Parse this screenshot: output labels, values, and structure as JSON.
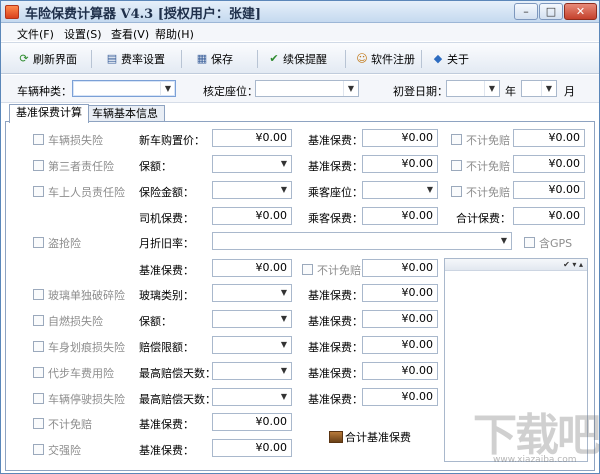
{
  "window": {
    "title": "车险保费计算器 V4.3 [授权用户：张建]",
    "min_glyph": "–",
    "max_glyph": "□",
    "close_glyph": "✕"
  },
  "menu": [
    "文件(F)",
    "设置(S)",
    "查看(V)",
    "帮助(H)"
  ],
  "toolbar": [
    {
      "label": "刷新界面",
      "icon": "refresh-icon",
      "glyph": "⟳"
    },
    {
      "label": "费率设置",
      "icon": "rate-settings-icon",
      "glyph": "▤"
    },
    {
      "label": "保存",
      "icon": "save-icon",
      "glyph": "▦"
    },
    {
      "label": "续保提醒",
      "icon": "checkmark-icon",
      "glyph": "✔"
    },
    {
      "label": "软件注册",
      "icon": "register-icon",
      "glyph": "☺"
    },
    {
      "label": "关于",
      "icon": "about-icon",
      "glyph": "◆"
    }
  ],
  "filter": {
    "vehicle_type_label": "车辆种类：",
    "seats_label": "核定座位：",
    "reg_date_label": "初登日期：",
    "year_label": "年",
    "month_label": "月"
  },
  "tabs": [
    "基准保费计算",
    "车辆基本信息"
  ],
  "rows": {
    "r1": {
      "check": "车辆损失险",
      "l1": "新车购置价：",
      "v1": "¥0.00",
      "l2": "基准保费：",
      "v2": "¥0.00",
      "check2": "不计免赔",
      "v3": "¥0.00"
    },
    "r2": {
      "check": "第三者责任险",
      "l1": "保额：",
      "l2": "基准保费：",
      "v2": "¥0.00",
      "check2": "不计免赔",
      "v3": "¥0.00"
    },
    "r3": {
      "check": "车上人员责任险",
      "l1": "保险金额：",
      "l2": "乘客座位：",
      "check2": "不计免赔",
      "v3": "¥0.00"
    },
    "r4": {
      "l1": "司机保费：",
      "v1": "¥0.00",
      "l2": "乘客保费：",
      "v2": "¥0.00",
      "l3": "合计保费：",
      "v3": "¥0.00"
    },
    "r5": {
      "check": "盗抢险",
      "l1": "月折旧率：",
      "gps": "含GPS"
    },
    "r6": {
      "l1": "基准保费：",
      "v1": "¥0.00",
      "check2": "不计免赔",
      "v2": "¥0.00"
    },
    "r7": {
      "check": "玻璃单独破碎险",
      "l1": "玻璃类别：",
      "l2": "基准保费：",
      "v2": "¥0.00"
    },
    "r8": {
      "check": "自燃损失险",
      "l1": "保额：",
      "l2": "基准保费：",
      "v2": "¥0.00"
    },
    "r9": {
      "check": "车身划痕损失险",
      "l1": "赔偿限额：",
      "l2": "基准保费：",
      "v2": "¥0.00"
    },
    "r10": {
      "check": "代步车费用险",
      "l1": "最高赔偿天数：",
      "l2": "基准保费：",
      "v2": "¥0.00"
    },
    "r11": {
      "check": "车辆停驶损失险",
      "l1": "最高赔偿天数：",
      "l2": "基准保费：",
      "v2": "¥0.00"
    },
    "r12": {
      "check": "不计免赔",
      "l1": "基准保费：",
      "v1": "¥0.00"
    },
    "r13": {
      "check": "交强险",
      "l1": "基准保费：",
      "v1": "¥0.00"
    }
  },
  "listbox_header": "✔ ▾ ▴",
  "sum_button": "合计基准保费",
  "watermark": "下载吧",
  "watermark_url": "www.xiazaiba.com"
}
